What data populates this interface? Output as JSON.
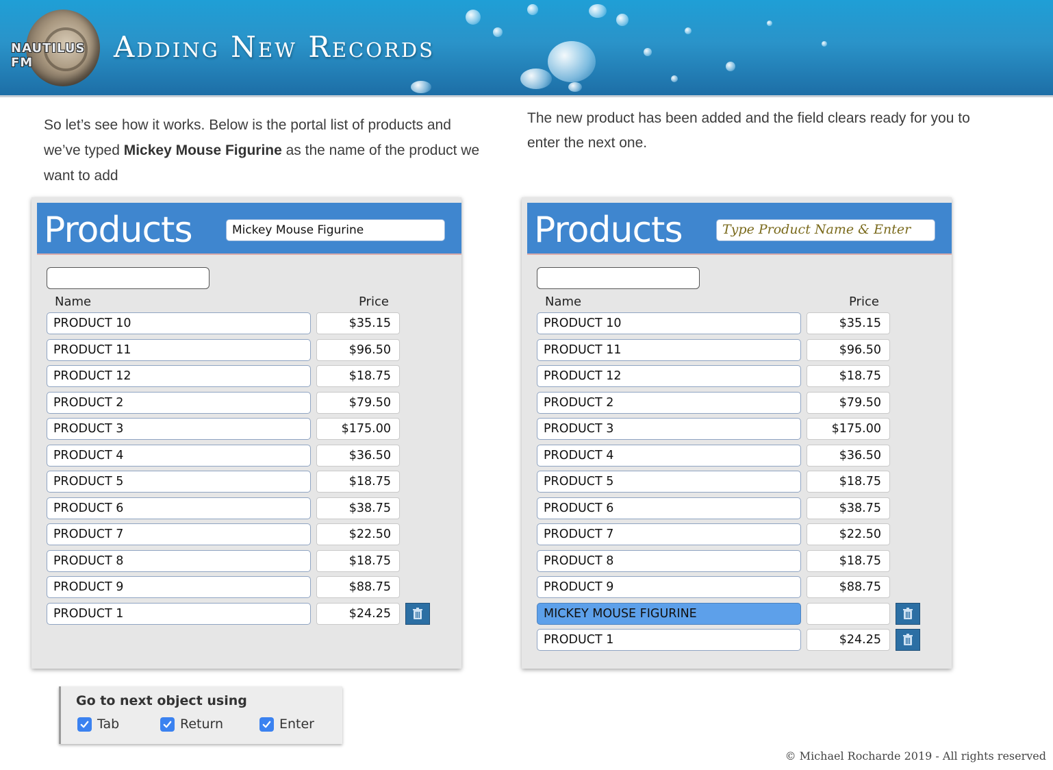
{
  "header": {
    "logo_text": "NAUTILUS FM",
    "title": "Adding New Records"
  },
  "captions": {
    "left": {
      "before": "So let’s see how it works. Below is the portal list of products and we’ve typed ",
      "bold": "Mickey Mouse Figurine",
      "after": " as the name of the product we want to add"
    },
    "right": "The new product has been added and the field clears ready for you to enter the next one."
  },
  "panels": {
    "left": {
      "title": "Products",
      "input_value": "Mickey Mouse Figurine",
      "col_name": "Name",
      "col_price": "Price",
      "rows": [
        {
          "name": "PRODUCT 10",
          "price": "$35.15"
        },
        {
          "name": "PRODUCT 11",
          "price": "$96.50"
        },
        {
          "name": "PRODUCT 12",
          "price": "$18.75"
        },
        {
          "name": "PRODUCT 2",
          "price": "$79.50"
        },
        {
          "name": "PRODUCT 3",
          "price": "$175.00"
        },
        {
          "name": "PRODUCT 4",
          "price": "$36.50"
        },
        {
          "name": "PRODUCT 5",
          "price": "$18.75"
        },
        {
          "name": "PRODUCT 6",
          "price": "$38.75"
        },
        {
          "name": "PRODUCT 7",
          "price": "$22.50"
        },
        {
          "name": "PRODUCT 8",
          "price": "$18.75"
        },
        {
          "name": "PRODUCT 9",
          "price": "$88.75"
        },
        {
          "name": "PRODUCT 1",
          "price": "$24.25"
        }
      ]
    },
    "right": {
      "title": "Products",
      "input_placeholder": "Type Product Name & Enter",
      "col_name": "Name",
      "col_price": "Price",
      "rows": [
        {
          "name": "PRODUCT 10",
          "price": "$35.15"
        },
        {
          "name": "PRODUCT 11",
          "price": "$96.50"
        },
        {
          "name": "PRODUCT 12",
          "price": "$18.75"
        },
        {
          "name": "PRODUCT 2",
          "price": "$79.50"
        },
        {
          "name": "PRODUCT 3",
          "price": "$175.00"
        },
        {
          "name": "PRODUCT 4",
          "price": "$36.50"
        },
        {
          "name": "PRODUCT 5",
          "price": "$18.75"
        },
        {
          "name": "PRODUCT 6",
          "price": "$38.75"
        },
        {
          "name": "PRODUCT 7",
          "price": "$22.50"
        },
        {
          "name": "PRODUCT 8",
          "price": "$18.75"
        },
        {
          "name": "PRODUCT 9",
          "price": "$88.75"
        },
        {
          "name": "MICKEY MOUSE FIGURINE",
          "price": ""
        },
        {
          "name": "PRODUCT 1",
          "price": "$24.25"
        }
      ]
    }
  },
  "prefs": {
    "title": "Go to next object using",
    "options": [
      {
        "label": "Tab",
        "checked": true
      },
      {
        "label": "Return",
        "checked": true
      },
      {
        "label": "Enter",
        "checked": true
      }
    ]
  },
  "colors": {
    "panel_header": "#3f86cf",
    "selected_row": "#5da0ea",
    "trash_button": "#2c6fa4",
    "checkbox": "#3b82f0"
  },
  "icons": {
    "trash": "trash-icon",
    "check": "checkmark-icon"
  },
  "copyright": "© Michael Rocharde 2019 - All rights reserved"
}
